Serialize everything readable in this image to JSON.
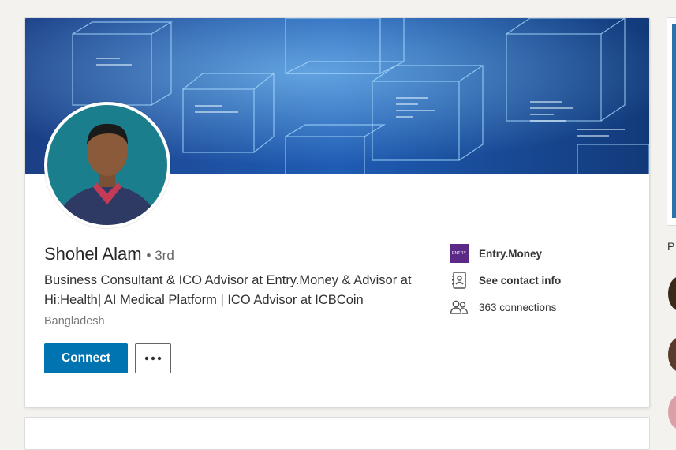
{
  "profile": {
    "name": "Shohel Alam",
    "degree": "3rd",
    "degree_separator": "•",
    "headline": "Business Consultant & ICO Advisor at Entry.Money & Advisor at Hi:Health| AI Medical Platform | ICO Advisor at ICBCoin",
    "location": "Bangladesh"
  },
  "actions": {
    "connect_label": "Connect"
  },
  "sidebar": {
    "company_logo_text": "ENTRY",
    "company": "Entry.Money",
    "contact_info": "See contact info",
    "connections": "363 connections"
  },
  "right_rail": {
    "heading_fragment": "P"
  },
  "colors": {
    "primary": "#0073b1",
    "background": "#f3f2ef",
    "entry_brand": "#5b2a86"
  },
  "icons": [
    "entry-money-logo",
    "contact-card-icon",
    "connections-people-icon",
    "more-ellipsis-icon"
  ]
}
